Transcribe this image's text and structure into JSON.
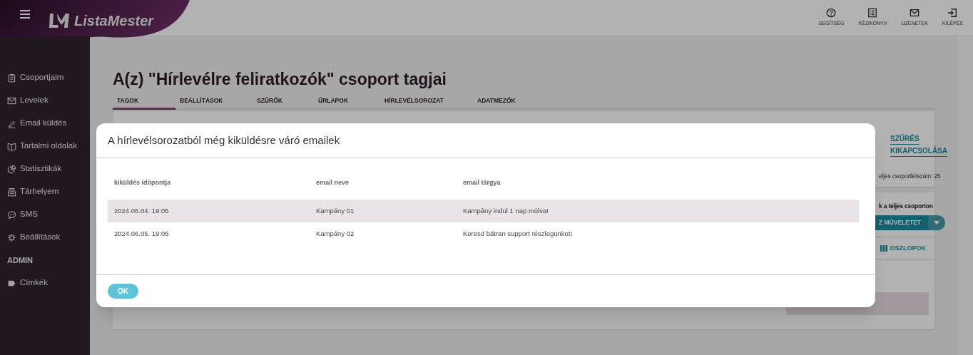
{
  "header": {
    "logo": "ListaMester",
    "actions": [
      {
        "label": "SEGÍTSÉG",
        "kind": "help"
      },
      {
        "label": "KÉZIKÖNYV",
        "kind": "manual"
      },
      {
        "label": "ÜZENETEK",
        "kind": "mail"
      },
      {
        "label": "KILÉPÉS",
        "kind": "exit"
      }
    ]
  },
  "sidebar": {
    "items": [
      {
        "label": "Csoportjaim",
        "kind": "clipboard"
      },
      {
        "label": "Levelek",
        "kind": "mail"
      },
      {
        "label": "Email küldés",
        "kind": "pencil"
      },
      {
        "label": "Tartalmi oldalak",
        "kind": "book"
      },
      {
        "label": "Statisztikák",
        "kind": "chart"
      },
      {
        "label": "Tárhelyem",
        "kind": "storage"
      },
      {
        "label": "SMS",
        "kind": "chat"
      },
      {
        "label": "Beállítások",
        "kind": "gear"
      },
      {
        "label": "ADMIN",
        "kind": "section"
      },
      {
        "label": "Címkék",
        "kind": "tag"
      }
    ]
  },
  "page": {
    "title": "A(z) \"Hírlevélre feliratkozók\" csoport tagjai",
    "tabs": [
      {
        "label": "TAGOK",
        "selected": true
      },
      {
        "label": "BEÁLLÍTÁSOK",
        "selected": false
      },
      {
        "label": "SZŰRŐK",
        "selected": false
      },
      {
        "label": "ŰRLAPOK",
        "selected": false
      },
      {
        "label": "HÍRLEVÉLSOROZAT",
        "selected": false
      },
      {
        "label": "ADATMEZŐK",
        "selected": false
      }
    ],
    "filter_card": {
      "link": "SZŰRÉS KIKAPCSOLÁSA",
      "count": "eljes csoportlétszám: 25"
    },
    "actions_card": {
      "caption": "k a teljes csoporton",
      "button": "Z MŰVELETET",
      "columns_button": "OSZLOPOK"
    }
  },
  "modal": {
    "title": "A hírlevélsorozatból még kiküldésre váró emailek",
    "columns": [
      "kiküldés időpontja",
      "email neve",
      "email tárgya"
    ],
    "rows": [
      {
        "cells": [
          "2024.06.04. 19:05",
          "Kampány 01",
          "Kampány indul 1 nap múlva!"
        ],
        "selected": true
      },
      {
        "cells": [
          "2024.06.05. 19:05",
          "Kampány 02",
          "Keresd bátran support részlegünket!"
        ],
        "selected": false
      }
    ],
    "ok": "OK"
  }
}
